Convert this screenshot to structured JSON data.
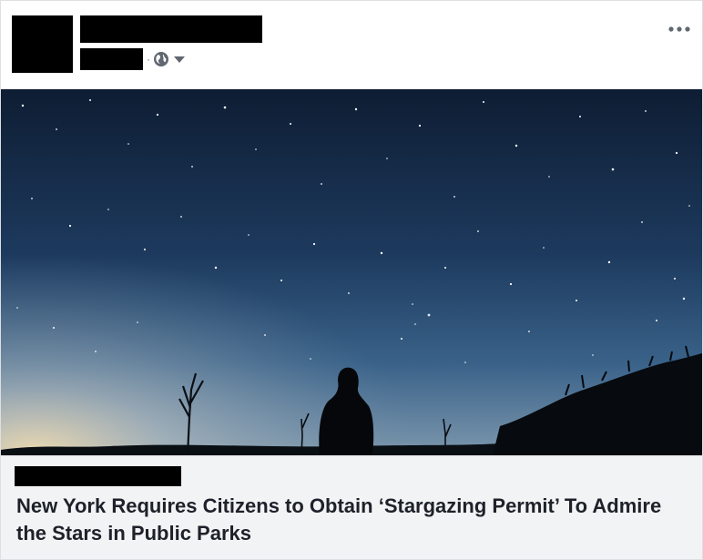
{
  "post": {
    "privacy_icon": "globe-icon",
    "audience_dropdown_icon": "caret-down-icon",
    "more_icon": "more-options-icon",
    "image": {
      "description_icon": "night-sky-photo"
    },
    "link": {
      "headline": "New York Requires Citizens to Obtain ‘Stargazing Permit’ To Admire the Stars in Public Parks"
    },
    "colors": {
      "headline": "#1d2129",
      "link_box_bg": "#f2f3f5",
      "border": "#dddfe2",
      "meta_gray": "#606770"
    }
  }
}
